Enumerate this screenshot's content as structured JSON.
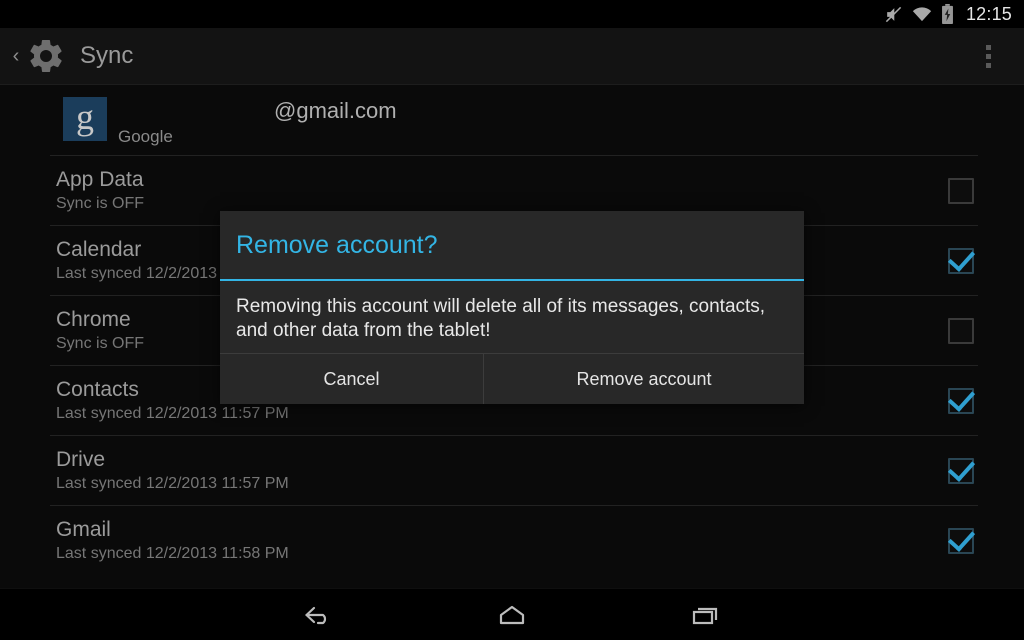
{
  "status_bar": {
    "clock": "12:15",
    "icons": [
      "mute-icon",
      "wifi-icon",
      "battery-charging-icon"
    ]
  },
  "action_bar": {
    "back_icon": "back-chevron-icon",
    "app_icon": "settings-gear-icon",
    "title": "Sync",
    "overflow_icon": "overflow-menu-icon"
  },
  "account": {
    "provider": "Google",
    "email": "@gmail.com",
    "logo_letter": "g",
    "logo_color": "#1b3d5b"
  },
  "sync_items": [
    {
      "title": "App Data",
      "status": "Sync is OFF",
      "checked": false
    },
    {
      "title": "Calendar",
      "status": "Last synced 12/2/2013",
      "checked": true
    },
    {
      "title": "Chrome",
      "status": "Sync is OFF",
      "checked": false
    },
    {
      "title": "Contacts",
      "status": "Last synced 12/2/2013 11:57 PM",
      "checked": true
    },
    {
      "title": "Drive",
      "status": "Last synced 12/2/2013 11:57 PM",
      "checked": true
    },
    {
      "title": "Gmail",
      "status": "Last synced 12/2/2013 11:58 PM",
      "checked": true
    }
  ],
  "dialog": {
    "title": "Remove account?",
    "message": "Removing this account will delete all of its messages, contacts, and other data from the tablet!",
    "cancel_label": "Cancel",
    "confirm_label": "Remove account",
    "accent_color": "#33b5e5"
  },
  "nav_bar": {
    "back_icon": "nav-back-icon",
    "home_icon": "nav-home-icon",
    "recents_icon": "nav-recents-icon"
  }
}
